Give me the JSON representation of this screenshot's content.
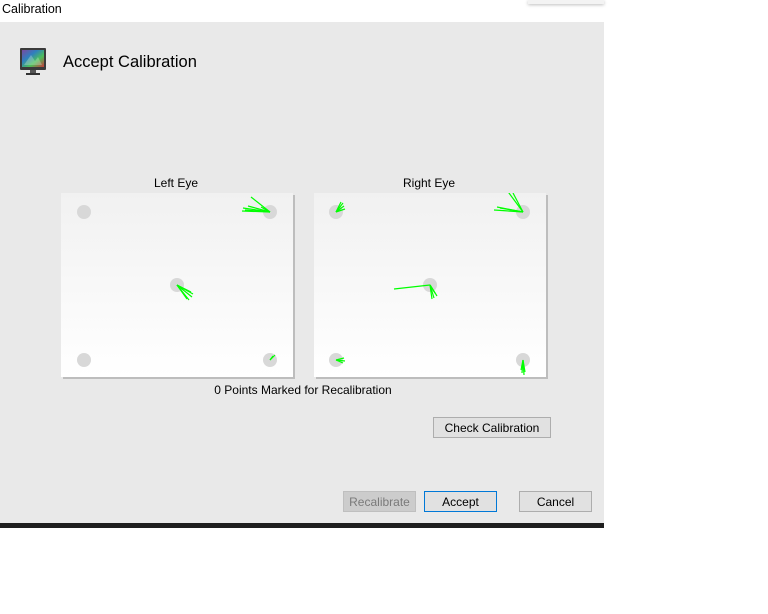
{
  "window": {
    "title": "Calibration"
  },
  "header": {
    "title": "Accept Calibration",
    "icon": "monitor-icon"
  },
  "panels": {
    "left": {
      "label": "Left Eye"
    },
    "right": {
      "label": "Right Eye"
    }
  },
  "status": {
    "points_marked": "0 Points Marked for Recalibration"
  },
  "buttons": {
    "check_calibration": "Check Calibration",
    "recalibrate": "Recalibrate",
    "accept": "Accept",
    "cancel": "Cancel"
  },
  "colors": {
    "gaze_vector": "#00ff00",
    "target_point": "#d8d8d8",
    "accent_border": "#0078d7"
  }
}
